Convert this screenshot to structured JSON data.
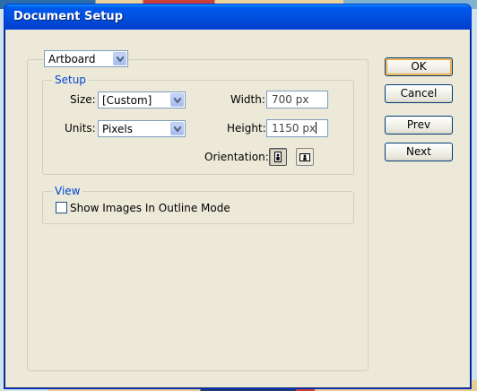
{
  "window": {
    "title": "Document Setup"
  },
  "top_select": {
    "value": "Artboard"
  },
  "setup": {
    "legend": "Setup",
    "size_label": "Size:",
    "size_value": "[Custom]",
    "units_label": "Units:",
    "units_value": "Pixels",
    "width_label": "Width:",
    "width_value": "700 px",
    "height_label": "Height:",
    "height_value": "1150 px",
    "orientation_label": "Orientation:",
    "orientation_selected": "portrait"
  },
  "view": {
    "legend": "View",
    "show_images_label": "Show Images In Outline Mode",
    "show_images_checked": false
  },
  "buttons": {
    "ok": "OK",
    "cancel": "Cancel",
    "prev": "Prev",
    "next": "Next"
  },
  "colors": {
    "title_bar": "#0050e0",
    "dialog_bg": "#ece9d8",
    "legend_text": "#0046d5",
    "default_button_highlight": "#e5a73a"
  },
  "icons": {
    "portrait": "orientation-portrait-icon",
    "landscape": "orientation-landscape-icon",
    "dropdown": "chevron-down-icon"
  }
}
